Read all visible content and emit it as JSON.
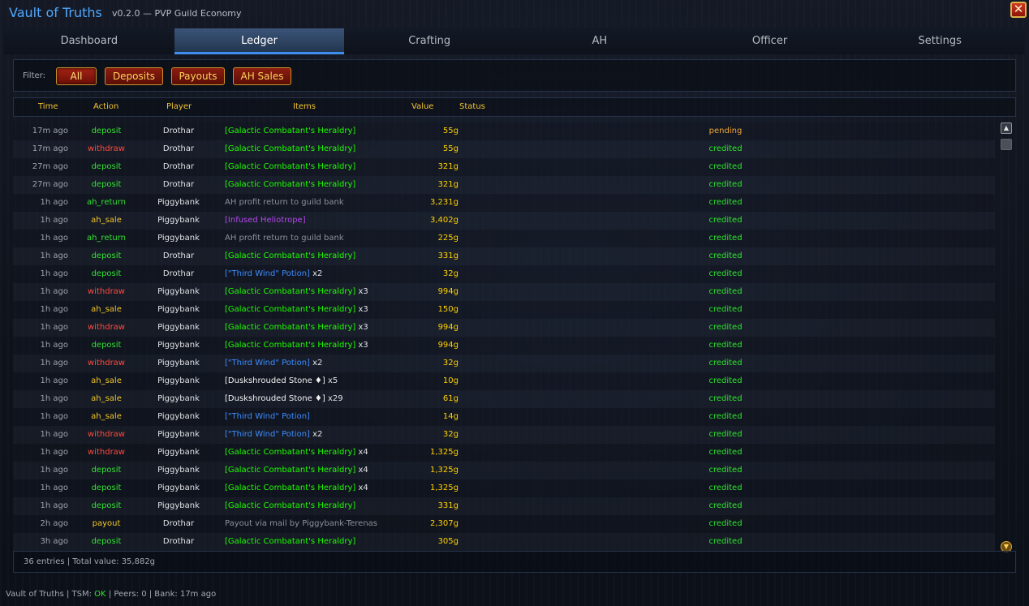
{
  "app": {
    "title": "Vault of Truths",
    "subtitle": "v0.2.0 — PVP Guild Economy",
    "close_symbol": "✕"
  },
  "tabs": [
    {
      "label": "Dashboard"
    },
    {
      "label": "Ledger"
    },
    {
      "label": "Crafting"
    },
    {
      "label": "AH"
    },
    {
      "label": "Officer"
    },
    {
      "label": "Settings"
    }
  ],
  "active_tab": "Ledger",
  "filter": {
    "label": "Filter:",
    "buttons": [
      "All",
      "Deposits",
      "Payouts",
      "AH Sales"
    ],
    "active": "All"
  },
  "columns": [
    "Time",
    "Action",
    "Player",
    "Items",
    "Value",
    "Status"
  ],
  "rows": [
    {
      "time": "17m ago",
      "action": "deposit",
      "player": "Drothar",
      "item": "[Galactic Combatant's Heraldry]",
      "item_color": "green",
      "qty": "",
      "value": "55g",
      "status": "pending"
    },
    {
      "time": "17m ago",
      "action": "withdraw",
      "player": "Drothar",
      "item": "[Galactic Combatant's Heraldry]",
      "item_color": "green",
      "qty": "",
      "value": "55g",
      "status": "credited"
    },
    {
      "time": "27m ago",
      "action": "deposit",
      "player": "Drothar",
      "item": "[Galactic Combatant's Heraldry]",
      "item_color": "green",
      "qty": "",
      "value": "321g",
      "status": "credited"
    },
    {
      "time": "27m ago",
      "action": "deposit",
      "player": "Drothar",
      "item": "[Galactic Combatant's Heraldry]",
      "item_color": "green",
      "qty": "",
      "value": "321g",
      "status": "credited"
    },
    {
      "time": "1h ago",
      "action": "ah_return",
      "player": "Piggybank",
      "item": "AH profit return to guild bank",
      "item_color": "gray",
      "qty": "",
      "value": "3,231g",
      "status": "credited"
    },
    {
      "time": "1h ago",
      "action": "ah_sale",
      "player": "Piggybank",
      "item": "[Infused Heliotrope]",
      "item_color": "purple",
      "qty": "",
      "value": "3,402g",
      "status": "credited"
    },
    {
      "time": "1h ago",
      "action": "ah_return",
      "player": "Piggybank",
      "item": "AH profit return to guild bank",
      "item_color": "gray",
      "qty": "",
      "value": "225g",
      "status": "credited"
    },
    {
      "time": "1h ago",
      "action": "deposit",
      "player": "Drothar",
      "item": "[Galactic Combatant's Heraldry]",
      "item_color": "green",
      "qty": "",
      "value": "331g",
      "status": "credited"
    },
    {
      "time": "1h ago",
      "action": "deposit",
      "player": "Drothar",
      "item": "[\"Third Wind\" Potion]",
      "item_color": "blue",
      "qty": "x2",
      "value": "32g",
      "status": "credited"
    },
    {
      "time": "1h ago",
      "action": "withdraw",
      "player": "Piggybank",
      "item": "[Galactic Combatant's Heraldry]",
      "item_color": "green",
      "qty": "x3",
      "value": "994g",
      "status": "credited"
    },
    {
      "time": "1h ago",
      "action": "ah_sale",
      "player": "Piggybank",
      "item": "[Galactic Combatant's Heraldry]",
      "item_color": "green",
      "qty": "x3",
      "value": "150g",
      "status": "credited"
    },
    {
      "time": "1h ago",
      "action": "withdraw",
      "player": "Piggybank",
      "item": "[Galactic Combatant's Heraldry]",
      "item_color": "green",
      "qty": "x3",
      "value": "994g",
      "status": "credited"
    },
    {
      "time": "1h ago",
      "action": "deposit",
      "player": "Piggybank",
      "item": "[Galactic Combatant's Heraldry]",
      "item_color": "green",
      "qty": "x3",
      "value": "994g",
      "status": "credited"
    },
    {
      "time": "1h ago",
      "action": "withdraw",
      "player": "Piggybank",
      "item": "[\"Third Wind\" Potion]",
      "item_color": "blue",
      "qty": "x2",
      "value": "32g",
      "status": "credited"
    },
    {
      "time": "1h ago",
      "action": "ah_sale",
      "player": "Piggybank",
      "item": "[Duskshrouded Stone ♦]",
      "item_color": "white",
      "qty": "x5",
      "value": "10g",
      "status": "credited"
    },
    {
      "time": "1h ago",
      "action": "ah_sale",
      "player": "Piggybank",
      "item": "[Duskshrouded Stone ♦]",
      "item_color": "white",
      "qty": "x29",
      "value": "61g",
      "status": "credited"
    },
    {
      "time": "1h ago",
      "action": "ah_sale",
      "player": "Piggybank",
      "item": "[\"Third Wind\" Potion]",
      "item_color": "blue",
      "qty": "",
      "value": "14g",
      "status": "credited"
    },
    {
      "time": "1h ago",
      "action": "withdraw",
      "player": "Piggybank",
      "item": "[\"Third Wind\" Potion]",
      "item_color": "blue",
      "qty": "x2",
      "value": "32g",
      "status": "credited"
    },
    {
      "time": "1h ago",
      "action": "withdraw",
      "player": "Piggybank",
      "item": "[Galactic Combatant's Heraldry]",
      "item_color": "green",
      "qty": "x4",
      "value": "1,325g",
      "status": "credited"
    },
    {
      "time": "1h ago",
      "action": "deposit",
      "player": "Piggybank",
      "item": "[Galactic Combatant's Heraldry]",
      "item_color": "green",
      "qty": "x4",
      "value": "1,325g",
      "status": "credited"
    },
    {
      "time": "1h ago",
      "action": "deposit",
      "player": "Piggybank",
      "item": "[Galactic Combatant's Heraldry]",
      "item_color": "green",
      "qty": "x4",
      "value": "1,325g",
      "status": "credited"
    },
    {
      "time": "1h ago",
      "action": "deposit",
      "player": "Piggybank",
      "item": "[Galactic Combatant's Heraldry]",
      "item_color": "green",
      "qty": "",
      "value": "331g",
      "status": "credited"
    },
    {
      "time": "2h ago",
      "action": "payout",
      "player": "Drothar",
      "item": "Payout via mail by Piggybank-Terenas",
      "item_color": "gray",
      "qty": "",
      "value": "2,307g",
      "status": "credited"
    },
    {
      "time": "3h ago",
      "action": "deposit",
      "player": "Drothar",
      "item": "[Galactic Combatant's Heraldry]",
      "item_color": "green",
      "qty": "",
      "value": "305g",
      "status": "credited"
    }
  ],
  "footer": {
    "summary": "36 entries | Total value: 35,882g"
  },
  "statusbar": {
    "app": "Vault of Truths",
    "tsm_label": "TSM:",
    "tsm_status": "OK",
    "peers": "Peers: 0",
    "bank": "Bank: 17m ago"
  },
  "icons": {
    "scroll_up": "scroll-up-icon",
    "scroll_down": "scroll-down-icon",
    "close": "close-icon"
  },
  "colors": {
    "title": "#4fa8ff",
    "gold": "#ffd100",
    "deposit": "#33e133",
    "withdraw": "#ff4a3d",
    "ah_sale": "#f0c528",
    "pending": "#f0a838",
    "credited": "#2ee52e",
    "item_green": "#1eff00",
    "item_blue": "#3d8cff",
    "item_purple": "#b448ee",
    "tab_active": "#3a5478"
  }
}
